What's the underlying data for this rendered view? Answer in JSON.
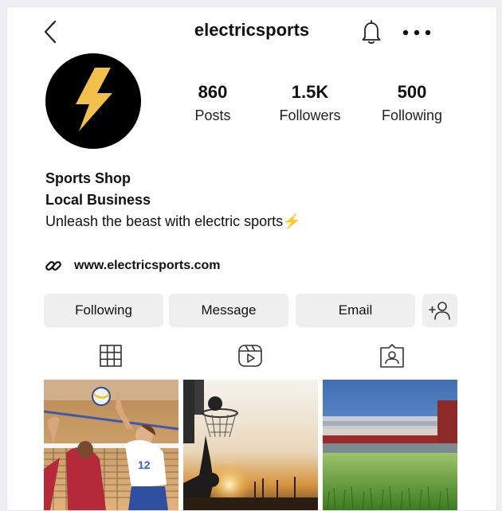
{
  "header": {
    "username": "electricsports"
  },
  "icons": {
    "back": "chevron-left-icon",
    "notifications": "bell-icon",
    "more": "more-horizontal-icon",
    "link": "link-icon",
    "add_person": "add-person-icon",
    "grid": "grid-icon",
    "reels": "reels-icon",
    "tagged": "tagged-icon"
  },
  "profile": {
    "avatar": "lightning-bolt-logo",
    "accent_color": "#f3c14b",
    "stats": [
      {
        "value": "860",
        "label": "Posts"
      },
      {
        "value": "1.5K",
        "label": "Followers"
      },
      {
        "value": "500",
        "label": "Following"
      }
    ],
    "bio": {
      "name": "Sports Shop",
      "category": "Local Business",
      "description": "Unleash the beast with electric sports",
      "emoji": "⚡"
    },
    "website": "www.electricsports.com"
  },
  "actions": {
    "following_label": "Following",
    "message_label": "Message",
    "email_label": "Email"
  },
  "posts": [
    {
      "subject": "volleyball"
    },
    {
      "subject": "basketball"
    },
    {
      "subject": "stadium"
    }
  ]
}
